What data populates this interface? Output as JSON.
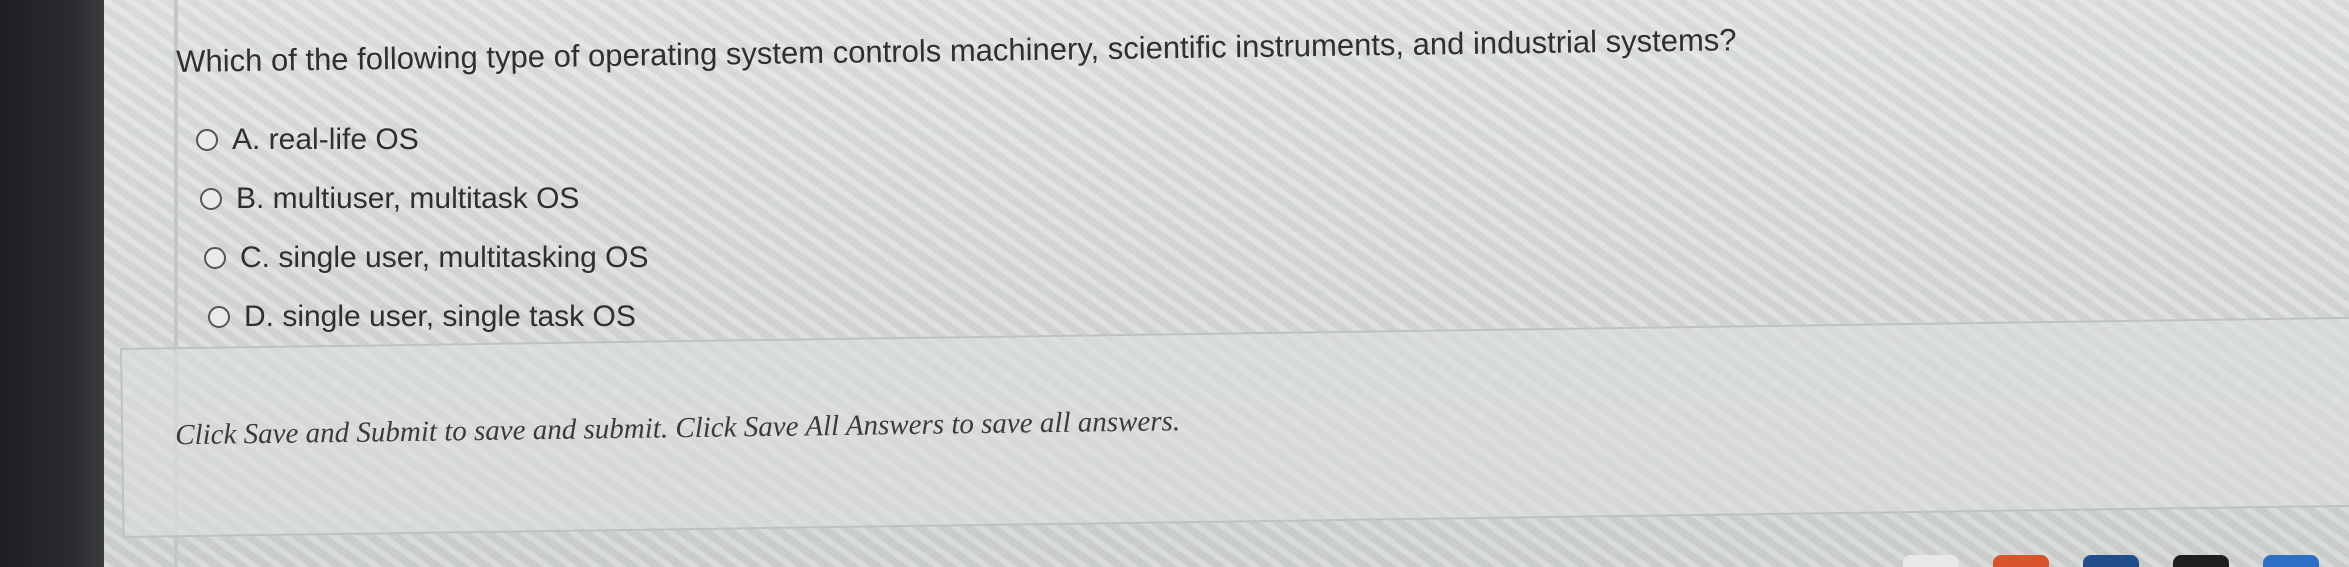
{
  "question": {
    "text": "Which of the following type of operating system controls machinery, scientific instruments, and industrial systems?"
  },
  "options": [
    {
      "label": "A. real-life OS"
    },
    {
      "label": "B. multiuser, multitask OS"
    },
    {
      "label": "C. single user, multitasking OS"
    },
    {
      "label": "D. single user, single task OS"
    }
  ],
  "instructions": {
    "text": "Click Save and Submit to save and submit. Click Save All Answers to save all answers."
  },
  "taskbar": {
    "icons": [
      {
        "name": "app-icon-1",
        "color": "#e8e8e8"
      },
      {
        "name": "app-icon-2",
        "color": "#d9532b"
      },
      {
        "name": "app-icon-3",
        "color": "#1f4e8a"
      },
      {
        "name": "app-icon-4",
        "color": "#1e1e1e"
      },
      {
        "name": "app-icon-5",
        "color": "#2d6fc4"
      }
    ]
  }
}
